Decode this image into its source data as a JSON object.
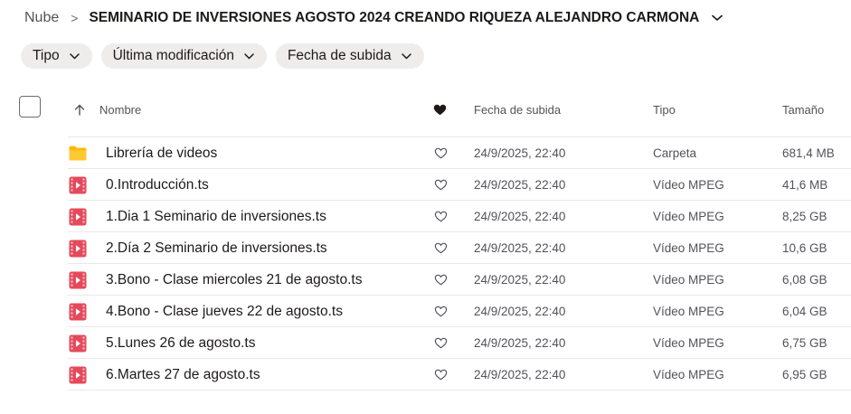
{
  "breadcrumb": {
    "root": "Nube",
    "separator": ">",
    "current": "SEMINARIO DE INVERSIONES AGOSTO 2024 CREANDO RIQUEZA ALEJANDRO CARMONA"
  },
  "filters": [
    {
      "label": "Tipo"
    },
    {
      "label": "Última modificación"
    },
    {
      "label": "Fecha de subida"
    }
  ],
  "columns": {
    "sort_icon": "arrow-up-icon",
    "name": "Nombre",
    "favorite_icon": "heart-filled-icon",
    "date": "Fecha de subida",
    "type": "Tipo",
    "size": "Tamaño"
  },
  "colors": {
    "folder": "#ffb800",
    "video_icon": "#e54a5c",
    "chip_bg": "#eeedec"
  },
  "files": [
    {
      "icon": "folder-icon",
      "name": "Librería de videos",
      "date": "24/9/2025, 22:40",
      "type": "Carpeta",
      "size": "681,4 MB"
    },
    {
      "icon": "video-file-icon",
      "name": "0.Introducción.ts",
      "date": "24/9/2025, 22:40",
      "type": "Vídeo MPEG",
      "size": "41,6 MB"
    },
    {
      "icon": "video-file-icon",
      "name": "1.Dia 1 Seminario de inversiones.ts",
      "date": "24/9/2025, 22:40",
      "type": "Vídeo MPEG",
      "size": "8,25 GB"
    },
    {
      "icon": "video-file-icon",
      "name": "2.Día 2 Seminario de inversiones.ts",
      "date": "24/9/2025, 22:40",
      "type": "Vídeo MPEG",
      "size": "10,6 GB"
    },
    {
      "icon": "video-file-icon",
      "name": "3.Bono - Clase miercoles 21 de agosto.ts",
      "date": "24/9/2025, 22:40",
      "type": "Vídeo MPEG",
      "size": "6,08 GB"
    },
    {
      "icon": "video-file-icon",
      "name": "4.Bono - Clase jueves 22 de agosto.ts",
      "date": "24/9/2025, 22:40",
      "type": "Vídeo MPEG",
      "size": "6,04 GB"
    },
    {
      "icon": "video-file-icon",
      "name": "5.Lunes 26 de agosto.ts",
      "date": "24/9/2025, 22:40",
      "type": "Vídeo MPEG",
      "size": "6,75 GB"
    },
    {
      "icon": "video-file-icon",
      "name": "6.Martes 27 de agosto.ts",
      "date": "24/9/2025, 22:40",
      "type": "Vídeo MPEG",
      "size": "6,95 GB"
    }
  ]
}
